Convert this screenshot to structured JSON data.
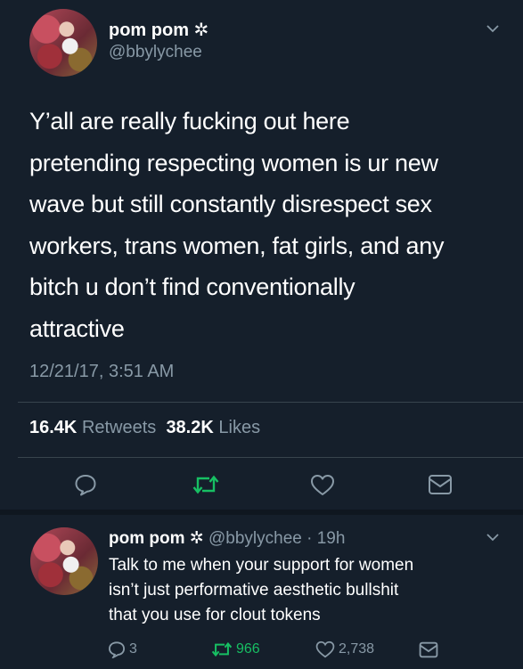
{
  "main_tweet": {
    "display_name": "pom pom ✲",
    "handle": "@bbylychee",
    "text_lines": [
      "Y’all are really fucking out here",
      "pretending respecting women is ur new",
      "wave but still constantly disrespect sex",
      "workers, trans women, fat girls, and any",
      "bitch u don’t find conventionally",
      "attractive"
    ],
    "timestamp": "12/21/17, 3:51 AM",
    "retweets_count": "16.4K",
    "retweets_label": "Retweets",
    "likes_count": "38.2K",
    "likes_label": "Likes",
    "actions": [
      "reply-icon",
      "retweet-icon",
      "like-icon",
      "message-icon"
    ]
  },
  "reply_tweet": {
    "display_name": "pom pom ✲",
    "handle_time": "@bbylychee · 19h",
    "text_lines": [
      "Talk to me when your support for women",
      "isn’t just performative aesthetic bullshit",
      "that you use for clout tokens"
    ],
    "reply_count": "3",
    "retweet_count": "966",
    "like_count": "2,738"
  },
  "colors": {
    "background": "#151f2b",
    "secondary_text": "#8899a6",
    "retweet_green": "#17bf63",
    "divider": "#38444d"
  }
}
